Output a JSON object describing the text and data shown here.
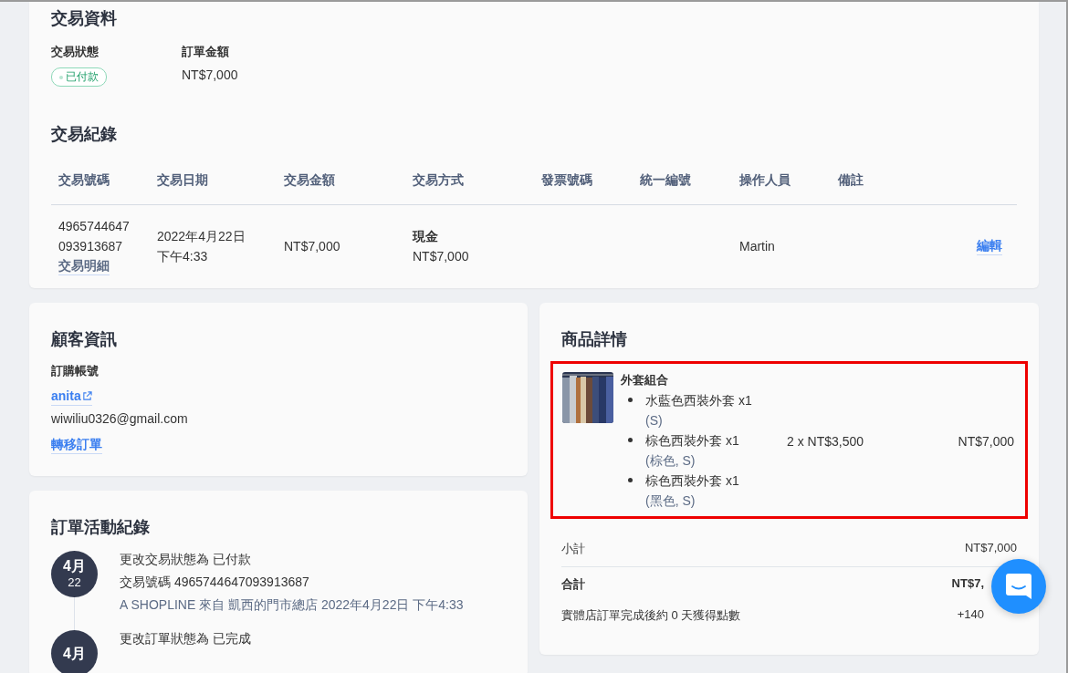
{
  "transaction_info": {
    "title": "交易資料",
    "status_label": "交易狀態",
    "status_badge": "已付款",
    "amount_label": "訂單金額",
    "amount": "NT$7,000"
  },
  "transaction_records": {
    "title": "交易紀錄",
    "columns": [
      "交易號碼",
      "交易日期",
      "交易金額",
      "交易方式",
      "發票號碼",
      "統一編號",
      "操作人員",
      "備註"
    ],
    "rows": [
      {
        "number_lines": [
          "4965744647",
          "093913687"
        ],
        "detail_link": "交易明細",
        "date_lines": [
          "2022年4月22日",
          "下午4:33"
        ],
        "amount": "NT$7,000",
        "method": "現金",
        "method_amount": "NT$7,000",
        "operator": "Martin",
        "edit_link": "編輯"
      }
    ]
  },
  "customer": {
    "title": "顧客資訊",
    "account_label": "訂購帳號",
    "account_link": "anita",
    "email": "wiwiliu0326@gmail.com",
    "transfer_link": "轉移訂單"
  },
  "activity": {
    "title": "訂單活動紀錄",
    "entries": [
      {
        "month": "4月",
        "day": "22",
        "lines": [
          "更改交易狀態為 已付款",
          "交易號碼 4965744647093913687"
        ],
        "meta": "A SHOPLINE 來自 凱西的門市總店 2022年4月22日 下午4:33"
      },
      {
        "month": "4月",
        "lines": [
          "更改訂單狀態為 已完成"
        ]
      }
    ]
  },
  "products": {
    "title": "商品詳情",
    "highlighted": true,
    "item": {
      "kind": "picture",
      "name": "外套組合",
      "components": [
        {
          "name": "水藍色西裝外套 x1",
          "variant": "(S)"
        },
        {
          "name": "棕色西裝外套 x1",
          "variant": "(棕色, S)"
        },
        {
          "name": "棕色西裝外套 x1",
          "variant": "(黑色, S)"
        }
      ],
      "unit_price": "2 x NT$3,500",
      "total": "NT$7,000"
    },
    "summary": [
      {
        "label": "小計",
        "value": "NT$7,000",
        "bold": false
      },
      {
        "label": "合計",
        "value": "NT$7,",
        "bold": true
      },
      {
        "label": "實體店訂單完成後約 0 天獲得點數",
        "value": "+140",
        "bold": false
      }
    ]
  }
}
